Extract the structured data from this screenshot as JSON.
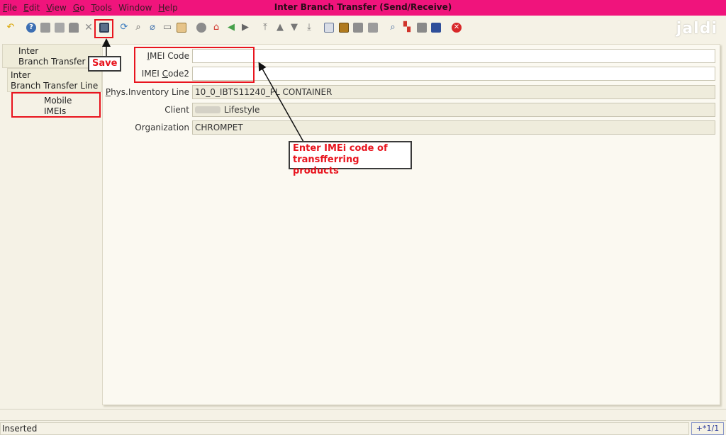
{
  "window": {
    "title": "Inter Branch Transfer (Send/Receive)"
  },
  "menu": [
    {
      "u": "F",
      "rest": "ile"
    },
    {
      "u": "E",
      "rest": "dit"
    },
    {
      "u": "V",
      "rest": "iew"
    },
    {
      "u": "G",
      "rest": "o"
    },
    {
      "u": "T",
      "rest": "ools"
    },
    {
      "u": "",
      "rest": "Window"
    },
    {
      "u": "H",
      "rest": "elp"
    }
  ],
  "logo": {
    "text": "jaldi"
  },
  "tabs": [
    {
      "line1": "Inter",
      "line2": "Branch Transfer"
    },
    {
      "line1": "Inter",
      "line2": "Branch Transfer Line"
    },
    {
      "line1": "Mobile",
      "line2": "IMEIs"
    }
  ],
  "form": {
    "imei_code": {
      "pre": "",
      "u": "I",
      "post": "MEI Code",
      "value": ""
    },
    "imei_code2": {
      "pre": "IMEI ",
      "u": "C",
      "post": "ode2",
      "value": ""
    },
    "phys_inventory_line": {
      "pre": "",
      "u": "P",
      "post": "hys.Inventory Line",
      "value": "10_0_IBTS11240_PL CONTAINER"
    },
    "client": {
      "pre": "",
      "u": "",
      "post": "Client",
      "value": "Lifestyle"
    },
    "organization": {
      "pre": "",
      "u": "",
      "post": "Organization",
      "value": "CHROMPET"
    }
  },
  "annotations": {
    "save": "Save",
    "enter_imei_line1": "Enter IMEi code of",
    "enter_imei_line2": "transfferring products"
  },
  "status": {
    "text": "Inserted",
    "record_info": "+*1/1"
  },
  "colors": {
    "titlebar": "#f0147c",
    "highlight": "#e8141e",
    "background": "#f5f2e6"
  }
}
